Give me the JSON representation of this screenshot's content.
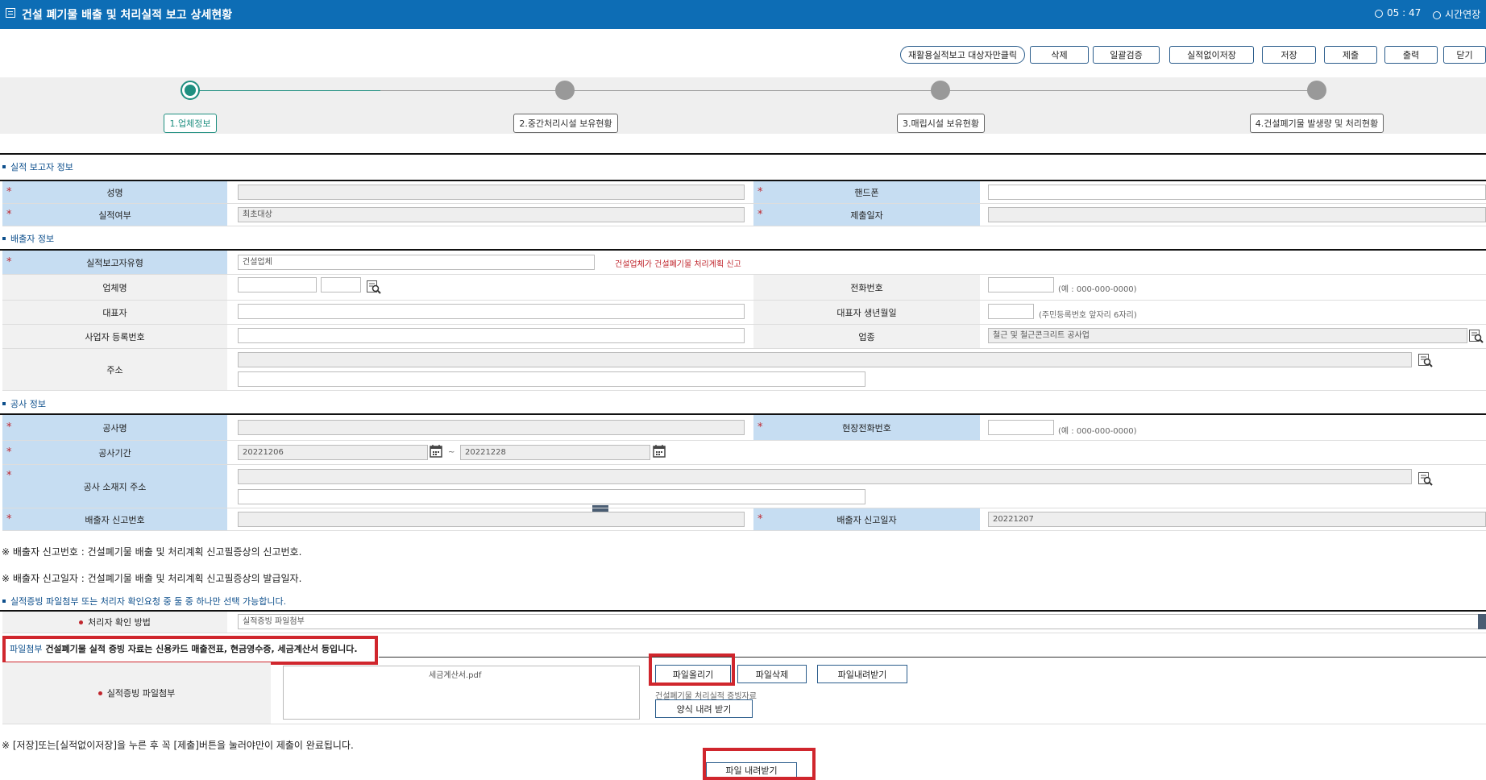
{
  "header": {
    "title": "건설 폐기물 배출 및 처리실적 보고 상세현황",
    "timer": "05 : 47",
    "extend_label": "시간연장"
  },
  "toolbar": {
    "buttons": [
      "재활용실적보고 대상자만클릭",
      "삭제",
      "일괄검증",
      "실적없이저장",
      "저장",
      "제출",
      "출력",
      "닫기"
    ]
  },
  "steps": [
    {
      "label": "1.업체정보",
      "active": true
    },
    {
      "label": "2.중간처리시설 보유현황",
      "active": false
    },
    {
      "label": "3.매립시설 보유현황",
      "active": false
    },
    {
      "label": "4.건설폐기물 발생량 및 처리현황",
      "active": false
    }
  ],
  "reporter": {
    "section_title": "실적 보고자 정보",
    "name_label": "성명",
    "phone_label": "핸드폰",
    "status_label": "실적여부",
    "status_value": "최초대상",
    "submit_date_label": "제출일자"
  },
  "emitter": {
    "section_title": "배출자 정보",
    "type_label": "실적보고자유형",
    "type_value": "건설업체",
    "type_hint": "건설업체가 건설폐기물 처리계획 신고",
    "company_label": "업체명",
    "tel_label": "전화번호",
    "tel_hint": "(예 : 000-000-0000)",
    "ceo_label": "대표자",
    "ceo_birth_label": "대표자 생년월일",
    "ceo_birth_hint": "(주민등록번호 앞자리 6자리)",
    "bizno_label": "사업자 등록번호",
    "industry_label": "업종",
    "industry_value": "철근 및 철근콘크리트 공사업",
    "address_label": "주소"
  },
  "construction": {
    "section_title": "공사 정보",
    "name_label": "공사명",
    "site_tel_label": "현장전화번호",
    "site_tel_hint": "(예 : 000-000-0000)",
    "period_label": "공사기간",
    "period_start": "20221206",
    "period_tilde": "~",
    "period_end": "20221228",
    "location_label": "공사 소재지 주소",
    "report_no_label": "배출자 신고번호",
    "report_date_label": "배출자 신고일자",
    "report_date_value": "20221207"
  },
  "notes": {
    "note1": "※ 배출자 신고번호 : 건설폐기물 배출 및 처리계획 신고필증상의 신고번호.",
    "note2": "※ 배출자 신고일자 : 건설폐기물 배출 및 처리계획 신고필증상의 발급일자.",
    "evidence_section": "실적증빙 파일첨부 또는 처리자 확인요청 중 둘 중 하나만 선택 가능합니다.",
    "final_note": "※ [저장]또는[실적없이저장]을 누른 후 꼭 [제출]버튼을 눌러야만이 제출이 완료됩니다."
  },
  "evidence": {
    "method_label": "처리자 확인 방법",
    "method_value": "실적증빙 파일첨부",
    "notice_prefix": "파일첨부",
    "notice_text": " 건설폐기물 실적 증빙 자료는 신용카드 매출전표, 현금영수증, 세금계산서 등입니다.",
    "file_label": "실적증빙 파일첨부",
    "file_name": "세금계산서.pdf",
    "upload_button": "파일올리기",
    "delete_button": "파일삭제",
    "download_button": "파일내려받기",
    "form_hint": "건설폐기물 처리실적 증빙자료",
    "form_button": "양식 내려 받기",
    "bottom_button": "파일 내려받기"
  },
  "colors": {
    "header_bg": "#0d6db5",
    "label_bg": "#c6ddf2",
    "active_step": "#1f8f80",
    "highlight": "#d0262d",
    "required": "#c0262d"
  }
}
